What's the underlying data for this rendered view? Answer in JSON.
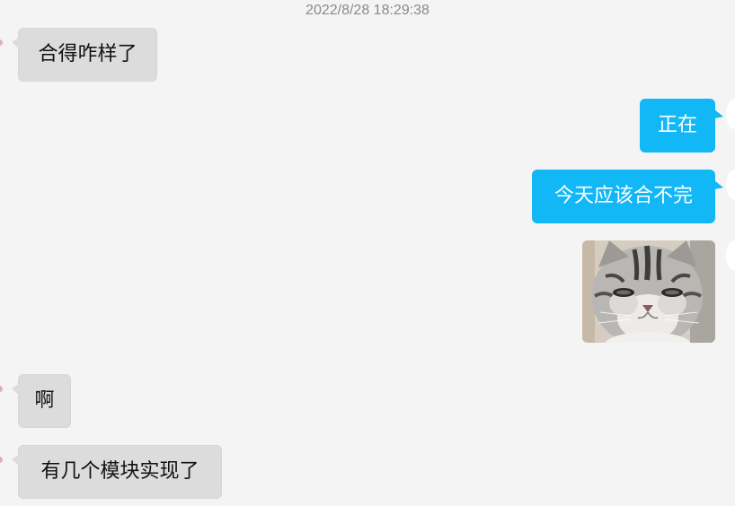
{
  "chat": {
    "timestamp": "2022/8/28 18:29:38",
    "messages": [
      {
        "id": "m1",
        "side": "in",
        "text": "合得咋样了"
      },
      {
        "id": "m2",
        "side": "out",
        "text": "正在"
      },
      {
        "id": "m3",
        "side": "out",
        "text": "今天应该合不完"
      },
      {
        "id": "m4",
        "side": "out",
        "type": "image",
        "content": "grey tabby cat face photo"
      },
      {
        "id": "m5",
        "side": "in",
        "text": "啊"
      },
      {
        "id": "m6",
        "side": "in",
        "text": "有几个模块实现了"
      }
    ]
  },
  "colors": {
    "background": "#f4f4f4",
    "incoming_bubble": "#dcdcdc",
    "outgoing_bubble": "#12b7f5",
    "timestamp_text": "#8a8a8a"
  }
}
